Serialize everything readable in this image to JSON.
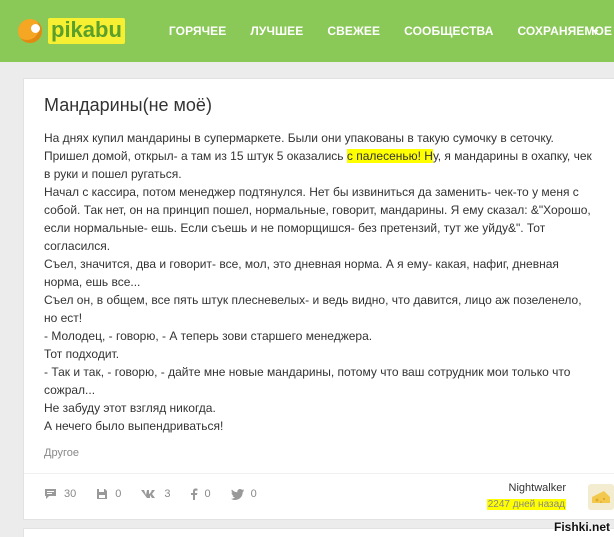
{
  "header": {
    "logo_text": "pikabu",
    "nav": [
      {
        "label": "ГОРЯЧЕЕ"
      },
      {
        "label": "ЛУЧШЕЕ"
      },
      {
        "label": "СВЕЖЕЕ"
      },
      {
        "label": "СООБЩЕСТВА"
      },
      {
        "label": "СОХРАНЯЕМОЕ"
      }
    ],
    "nav_arrow": "▼"
  },
  "post": {
    "title": "Мандарины(не моё)",
    "p1_a": "На днях купил мандарины в супермаркете. Были они упакованы в такую сумочку в сеточку. Пришел домой, открыл- а там из 15 штук 5 оказались ",
    "p1_hl": "с палесенью! Н",
    "p1_b": "у, я мандарины в охапку, чек в руки и пошел ругаться.",
    "p2": "Начал с кассира, потом менеджер подтянулся. Нет бы извиниться да заменить- чек-то у меня с собой. Так нет, он на принцип пошел, нормальные, говорит, мандарины. Я ему сказал: &\"Хорошо, если нормальные- ешь. Если съешь и не поморщишся- без претензий, тут же уйду&\". Тот согласился.",
    "p3": "Съел, значится, два и говорит- все, мол, это дневная норма. А я ему- какая, нафиг, дневная норма, ешь все...",
    "p4": "Съел он, в общем, все пять штук плесневелых- и ведь видно, что давится, лицо аж позеленело, но ест!",
    "p5": "- Молодец, - говорю, - А теперь зови старшего менеджера.",
    "p6": "Тот подходит.",
    "p7": "- Так и так, - говорю, - дайте мне новые мандарины, потому что ваш сотрудник мои только что сожрал...",
    "p8": "Не забуду этот взгляд никогда.",
    "p9": "А нечего было выпендриваться!",
    "tag": "Другое",
    "stats": {
      "comments": "30",
      "saves": "0",
      "vk": "3",
      "fb": "0",
      "tw": "0"
    },
    "author": "Nightwalker",
    "time_ago": "2247 дней назад"
  },
  "watermark": "Fishki.net",
  "colors": {
    "header_bg": "#8ac858",
    "highlight": "#ffff00"
  }
}
